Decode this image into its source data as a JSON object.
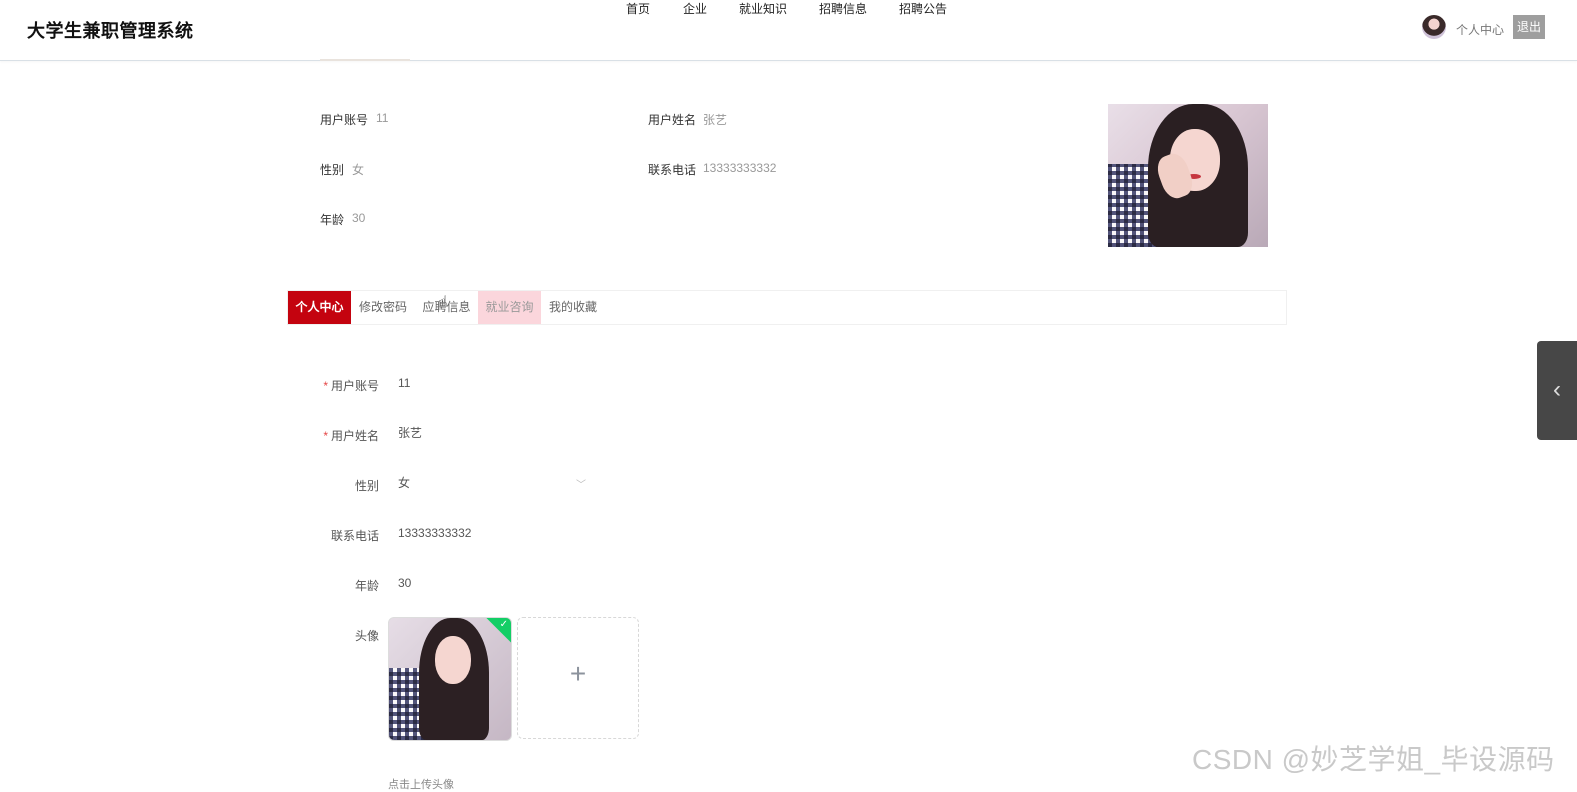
{
  "header": {
    "brand": "大学生兼职管理系统",
    "nav": [
      "首页",
      "企业",
      "就业知识",
      "招聘信息",
      "招聘公告"
    ],
    "user_center": "个人中心",
    "logout": "退出"
  },
  "profile": {
    "account_label": "用户账号",
    "account_value": "11",
    "name_label": "用户姓名",
    "name_value": "张艺",
    "gender_label": "性别",
    "gender_value": "女",
    "phone_label": "联系电话",
    "phone_value": "13333333332",
    "age_label": "年龄",
    "age_value": "30"
  },
  "tabs": [
    "个人中心",
    "修改密码",
    "应聘信息",
    "就业咨询",
    "我的收藏"
  ],
  "form": {
    "account_label": "用户账号",
    "account_value": "11",
    "name_label": "用户姓名",
    "name_value": "张艺",
    "gender_label": "性别",
    "gender_value": "女",
    "phone_label": "联系电话",
    "phone_value": "13333333332",
    "age_label": "年龄",
    "age_value": "30",
    "avatar_label": "头像",
    "upload_plus": "+",
    "upload_tip": "点击上传头像"
  },
  "side_tab_icon": "‹",
  "watermark": "CSDN @妙芝学姐_毕设源码",
  "colors": {
    "accent": "#c4030f",
    "hover_tab": "#fbd6dc",
    "success": "#13ce66"
  }
}
